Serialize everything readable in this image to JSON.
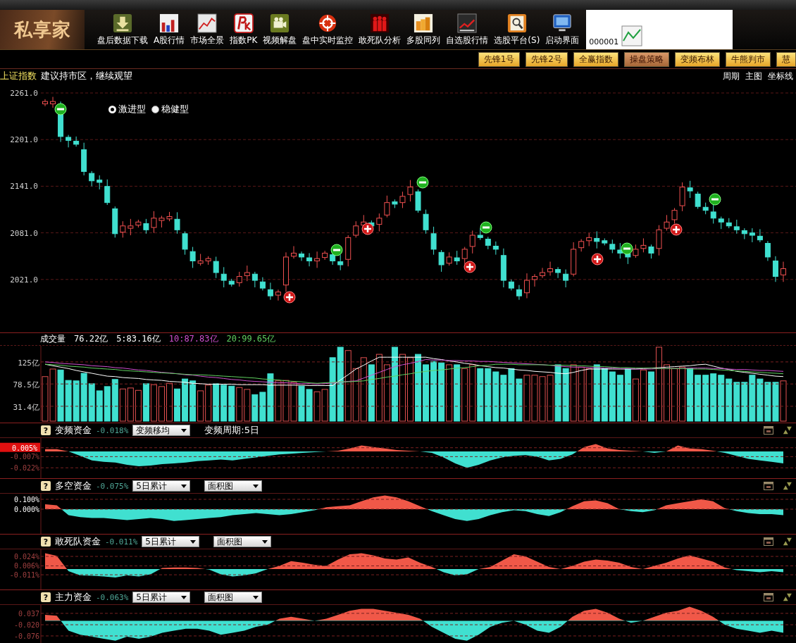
{
  "toolbar": {
    "logo": "私享家",
    "items": [
      {
        "label": "盘后数据下载"
      },
      {
        "label": "A股行情"
      },
      {
        "label": "市场全景"
      },
      {
        "label": "指数PK"
      },
      {
        "label": "视频解盘"
      },
      {
        "label": "盘中实时监控"
      },
      {
        "label": "敢死队分析"
      },
      {
        "label": "多股同列"
      },
      {
        "label": "自选股行情"
      },
      {
        "label": "选股平台(S)"
      },
      {
        "label": "启动界面"
      }
    ],
    "code_field": {
      "value": "000001"
    }
  },
  "strategy_buttons": [
    {
      "label": "先锋1号",
      "selected": false
    },
    {
      "label": "先锋2号",
      "selected": false
    },
    {
      "label": "全赢指数",
      "selected": false
    },
    {
      "label": "操盘策略",
      "selected": true
    },
    {
      "label": "变频布林",
      "selected": false
    },
    {
      "label": "牛熊判市",
      "selected": false
    },
    {
      "label": "慧",
      "selected": false
    }
  ],
  "main_chart": {
    "index_name": "上证指数",
    "advice": "建议持市区，继续观望",
    "menu": [
      "周期",
      "主图",
      "坐标线"
    ],
    "y_axis_labels": [
      "2261.0",
      "2201.0",
      "2141.0",
      "2081.0",
      "2021.0"
    ],
    "modes": [
      {
        "label": "激进型",
        "selected": true
      },
      {
        "label": "稳健型",
        "selected": false
      }
    ]
  },
  "volume": {
    "title": "成交量",
    "readings": [
      {
        "text": "76.22亿",
        "color": "#ffffff"
      },
      {
        "text": "5:83.16亿",
        "color": "#ffffff"
      },
      {
        "text": "10:87.83亿",
        "color": "#d050d0"
      },
      {
        "text": "20:99.65亿",
        "color": "#60d060"
      }
    ],
    "chart_data": {
      "type": "bar",
      "grid": true,
      "ylim": [
        0,
        159
      ],
      "yticks": [
        {
          "value": 125,
          "label": "125亿"
        },
        {
          "value": 78.5,
          "label": "78.5亿"
        },
        {
          "value": 31.4,
          "label": "31.4亿"
        }
      ],
      "series": [
        {
          "color": "#e05050",
          "values": [
            94,
            110,
            null,
            null,
            null,
            null,
            null,
            null,
            null,
            null,
            68,
            70,
            65,
            null,
            77,
            73,
            80,
            null,
            null,
            null,
            64,
            76,
            null,
            null,
            null,
            71,
            67,
            null,
            null,
            null,
            85,
            86,
            82,
            null,
            null,
            62,
            67,
            null,
            null,
            149,
            111,
            134,
            null,
            141,
            119,
            null,
            141,
            134,
            null,
            null,
            null,
            null,
            119,
            null,
            111,
            119,
            null,
            null,
            null,
            null,
            null,
            null,
            97,
            97,
            94,
            97,
            null,
            null,
            119,
            114,
            111,
            null,
            null,
            null,
            null,
            null,
            89,
            108,
            null,
            156,
            119,
            111,
            114,
            null,
            null,
            null,
            null,
            null,
            null,
            null,
            null,
            null,
            null,
            null,
            null,
            85
          ]
        },
        {
          "color": "#40e0d0",
          "values": [
            null,
            null,
            108,
            86,
            85,
            101,
            79,
            64,
            73,
            88,
            null,
            null,
            null,
            79,
            null,
            null,
            null,
            68,
            89,
            85,
            null,
            null,
            79,
            76,
            74,
            null,
            null,
            56,
            61,
            100,
            null,
            null,
            null,
            74,
            67,
            null,
            null,
            134,
            156,
            null,
            null,
            null,
            119,
            null,
            null,
            156,
            null,
            null,
            141,
            119,
            126,
            123,
            null,
            119,
            null,
            null,
            111,
            111,
            104,
            97,
            111,
            89,
            null,
            null,
            null,
            null,
            119,
            111,
            null,
            null,
            null,
            119,
            111,
            104,
            97,
            111,
            null,
            null,
            104,
            null,
            null,
            null,
            null,
            111,
            97,
            97,
            100,
            97,
            89,
            82,
            82,
            97,
            89,
            82,
            82,
            null
          ]
        },
        {
          "type": "line",
          "color": "#ffffff",
          "values": [
            120,
            117,
            114,
            111,
            107,
            104,
            101,
            98,
            95,
            94,
            92,
            91,
            90,
            88,
            87,
            86,
            84,
            83,
            82,
            80,
            79,
            78,
            78,
            78,
            78,
            77,
            77,
            77,
            77,
            76,
            76,
            76,
            76,
            76,
            75,
            75,
            75,
            75,
            87,
            98,
            110,
            118,
            127,
            135,
            135,
            135,
            135,
            135,
            135,
            135,
            132,
            130,
            127,
            125,
            122,
            120,
            117,
            115,
            113,
            112,
            110,
            108,
            107,
            105,
            104,
            103,
            101,
            100,
            103,
            107,
            110,
            110,
            110,
            110,
            110,
            110,
            110,
            111,
            112,
            113,
            114,
            115,
            116,
            117,
            119,
            120,
            116,
            112,
            109,
            105,
            103,
            101,
            99,
            97,
            95,
            94
          ]
        },
        {
          "type": "line",
          "color": "#d050d0",
          "values": [
            125,
            124,
            122,
            121,
            120,
            119,
            117,
            116,
            115,
            113,
            112,
            110,
            108,
            107,
            105,
            103,
            102,
            100,
            98,
            97,
            95,
            93,
            92,
            90,
            88,
            87,
            85,
            84,
            83,
            82,
            81,
            81,
            80,
            79,
            79,
            78,
            79,
            81,
            82,
            84,
            85,
            91,
            97,
            103,
            109,
            115,
            119,
            122,
            126,
            130,
            129,
            129,
            128,
            128,
            127,
            127,
            126,
            126,
            125,
            124,
            123,
            122,
            121,
            120,
            119,
            118,
            116,
            115,
            114,
            114,
            113,
            113,
            112,
            112,
            111,
            111,
            110,
            110,
            110,
            111,
            111,
            111,
            111,
            112,
            112,
            112,
            111,
            111,
            110,
            109,
            109,
            108,
            107,
            107,
            106,
            105
          ]
        },
        {
          "type": "line",
          "color": "#60d060",
          "values": [
            120,
            119,
            118,
            116,
            115,
            114,
            112,
            111,
            110,
            109,
            107,
            106,
            105,
            104,
            103,
            102,
            101,
            100,
            99,
            98,
            98,
            97,
            96,
            95,
            94,
            93,
            92,
            91,
            89,
            88,
            87,
            85,
            84,
            83,
            81,
            80,
            81,
            82,
            83,
            83,
            84,
            85,
            88,
            90,
            93,
            95,
            98,
            100,
            103,
            105,
            107,
            108,
            110,
            112,
            113,
            115,
            117,
            118,
            120,
            120,
            120,
            119,
            119,
            119,
            119,
            118,
            118,
            118,
            117,
            117,
            116,
            115,
            115,
            114,
            113,
            113,
            112,
            112,
            112,
            111,
            111,
            111,
            111,
            110,
            110,
            110,
            109,
            108,
            107,
            106,
            105,
            104,
            103,
            102,
            101,
            100
          ]
        }
      ]
    }
  },
  "panels": [
    {
      "help": "?",
      "title": "变频资金",
      "reading": "-0.018%",
      "highlight_first_tick": true,
      "controls": [
        {
          "kind": "dropdown",
          "value": "变频移均"
        },
        {
          "kind": "label",
          "text": "变频周期:5日"
        }
      ],
      "chart_data": {
        "type": "area",
        "grid": true,
        "ylim": [
          -0.036,
          0.018
        ],
        "yticks": [
          {
            "value": 0.005,
            "label": "0.005%"
          },
          {
            "value": -0.007,
            "label": "-0.007%"
          },
          {
            "value": -0.022,
            "label": "-0.022%"
          }
        ],
        "series": [
          {
            "color": "#40e0d0",
            "values": [
              0.003,
              0.003,
              0.0,
              -0.006,
              -0.012,
              -0.014,
              -0.015,
              -0.018,
              -0.02,
              -0.019,
              -0.017,
              -0.016,
              -0.015,
              -0.013,
              -0.012,
              -0.011,
              -0.012,
              -0.01,
              -0.008,
              -0.006,
              -0.004,
              -0.003,
              -0.002,
              -0.001,
              0.0,
              0.001,
              0.004,
              0.008,
              0.006,
              0.004,
              0.002,
              0.001,
              0.0,
              -0.002,
              -0.008,
              -0.016,
              -0.022,
              -0.018,
              -0.012,
              -0.008,
              -0.006,
              -0.005,
              -0.007,
              -0.012,
              -0.01,
              -0.004,
              0.006,
              0.01,
              0.004,
              0.002,
              0.001,
              0.0,
              -0.002,
              0.0,
              0.008,
              0.004,
              0.003,
              0.001,
              -0.002,
              -0.006,
              -0.01,
              -0.012,
              -0.014,
              -0.016
            ]
          }
        ]
      }
    },
    {
      "help": "?",
      "title": "多空资金",
      "reading": "-0.075%",
      "highlight_first_tick": false,
      "controls": [
        {
          "kind": "dropdown",
          "value": "5日累计"
        },
        {
          "kind": "dropdown",
          "value": "面积图"
        }
      ],
      "chart_data": {
        "type": "area",
        "grid": true,
        "ylim": [
          -0.25,
          0.157
        ],
        "yticks": [
          {
            "value": 0.1,
            "label": "0.100%"
          },
          {
            "value": 0,
            "label": "0.000%"
          }
        ],
        "series": [
          {
            "color": "#40e0d0",
            "values": [
              0.05,
              0.04,
              -0.06,
              -0.08,
              -0.09,
              -0.09,
              -0.1,
              -0.11,
              -0.1,
              -0.09,
              -0.1,
              -0.12,
              -0.11,
              -0.1,
              -0.09,
              -0.08,
              -0.06,
              -0.05,
              -0.04,
              -0.05,
              -0.06,
              -0.05,
              -0.03,
              -0.01,
              0.02,
              0.03,
              0.04,
              0.08,
              0.12,
              0.14,
              0.12,
              0.08,
              0.03,
              -0.02,
              -0.06,
              -0.1,
              -0.12,
              -0.1,
              -0.06,
              -0.03,
              -0.01,
              -0.02,
              -0.05,
              -0.07,
              -0.03,
              0.03,
              0.08,
              0.09,
              0.06,
              0.0,
              -0.02,
              -0.03,
              -0.01,
              0.04,
              0.06,
              0.08,
              0.1,
              0.08,
              0.01,
              -0.02,
              -0.04,
              -0.05,
              -0.05,
              -0.06
            ]
          }
        ]
      }
    },
    {
      "help": "?",
      "title": "敢死队资金",
      "reading": "-0.011%",
      "highlight_first_tick": false,
      "controls": [
        {
          "kind": "dropdown",
          "value": "5日累计"
        },
        {
          "kind": "dropdown",
          "value": "面积图"
        }
      ],
      "chart_data": {
        "type": "area",
        "grid": true,
        "ylim": [
          -0.039,
          0.0375
        ],
        "yticks": [
          {
            "value": 0.024,
            "label": "0.024%"
          },
          {
            "value": 0.006,
            "label": "0.006%"
          },
          {
            "value": -0.011,
            "label": "-0.011%"
          }
        ],
        "series": [
          {
            "color": "#40e0d0",
            "values": [
              0.03,
              0.025,
              -0.004,
              -0.012,
              -0.013,
              -0.014,
              -0.016,
              -0.012,
              -0.014,
              -0.01,
              0.002,
              0.003,
              0.003,
              0.002,
              -0.001,
              -0.01,
              -0.014,
              -0.012,
              -0.008,
              0.0,
              0.006,
              0.015,
              0.012,
              0.008,
              0.006,
              0.018,
              0.028,
              0.03,
              0.026,
              0.02,
              0.018,
              0.022,
              0.012,
              0.004,
              -0.006,
              -0.012,
              -0.01,
              0.0,
              0.004,
              0.016,
              0.028,
              0.024,
              0.014,
              0.004,
              0.0,
              0.006,
              0.014,
              0.018,
              0.016,
              0.012,
              0.004,
              0.0,
              0.006,
              0.012,
              0.02,
              0.026,
              0.02,
              0.014,
              0.003,
              -0.002,
              -0.004,
              -0.006,
              -0.004,
              -0.006
            ]
          }
        ]
      }
    },
    {
      "help": "?",
      "title": "主力资金",
      "reading": "-0.063%",
      "highlight_first_tick": false,
      "controls": [
        {
          "kind": "dropdown",
          "value": "5日累计"
        },
        {
          "kind": "dropdown",
          "value": "面积图"
        }
      ],
      "chart_data": {
        "type": "area",
        "grid": true,
        "ylim": [
          -0.122,
          0.079
        ],
        "yticks": [
          {
            "value": 0.037,
            "label": "0.037"
          },
          {
            "value": -0.02,
            "label": "-0.020"
          },
          {
            "value": -0.076,
            "label": "-0.076"
          }
        ],
        "series": [
          {
            "color": "#40e0d0",
            "values": [
              0.03,
              0.025,
              -0.05,
              -0.07,
              -0.08,
              -0.09,
              -0.1,
              -0.08,
              -0.09,
              -0.08,
              -0.06,
              -0.05,
              -0.04,
              -0.04,
              -0.05,
              -0.07,
              -0.06,
              -0.05,
              -0.03,
              -0.02,
              0.01,
              0.02,
              0.01,
              0.0,
              0.01,
              0.03,
              0.05,
              0.06,
              0.06,
              0.05,
              0.04,
              0.03,
              0.01,
              -0.03,
              -0.06,
              -0.09,
              -0.1,
              -0.07,
              -0.03,
              -0.01,
              0.0,
              -0.02,
              -0.05,
              -0.06,
              -0.03,
              0.02,
              0.05,
              0.06,
              0.04,
              0.01,
              -0.01,
              0.0,
              0.02,
              0.04,
              0.05,
              0.07,
              0.05,
              0.02,
              -0.02,
              -0.04,
              -0.05,
              -0.06,
              -0.05,
              -0.06
            ]
          }
        ]
      }
    }
  ]
}
